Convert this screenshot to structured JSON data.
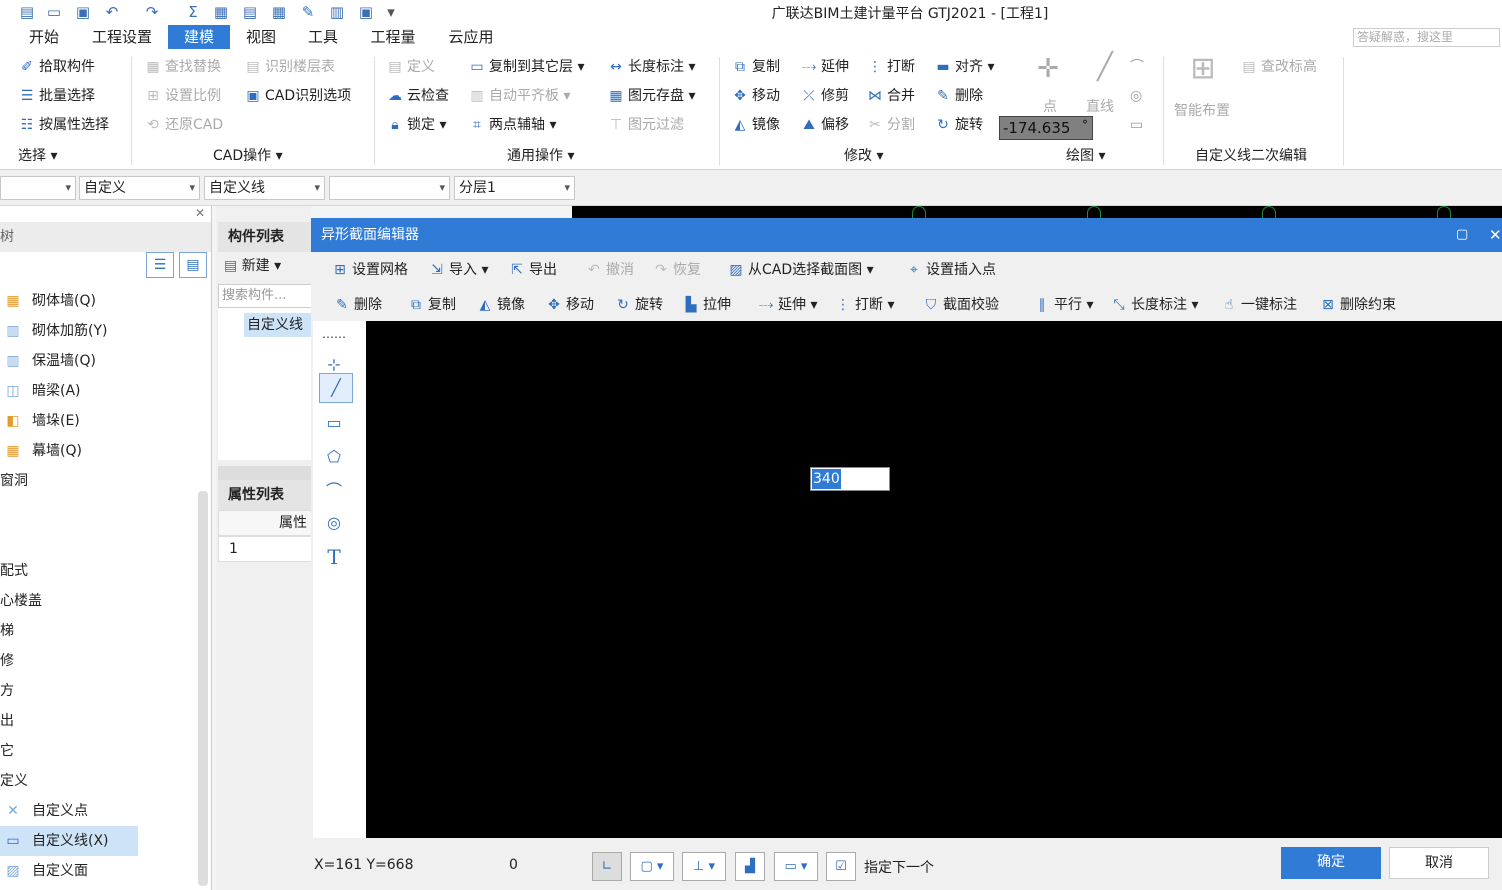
{
  "window": {
    "title": "广联达BIM土建计量平台 GTJ2021 - [工程1]",
    "help_placeholder": "答疑解惑，搜这里"
  },
  "tabs": [
    "开始",
    "工程设置",
    "建模",
    "视图",
    "工具",
    "工程量",
    "云应用"
  ],
  "ribbon": {
    "select": {
      "items": [
        "拾取构件",
        "批量选择",
        "按属性选择"
      ],
      "group": "选择"
    },
    "cad": {
      "items": [
        "查找替换",
        "识别楼层表",
        "设置比例",
        "CAD识别选项",
        "还原CAD"
      ],
      "group": "CAD操作"
    },
    "common": {
      "items": [
        "定义",
        "复制到其它层",
        "长度标注",
        "云检查",
        "自动平齐板",
        "图元存盘",
        "锁定",
        "两点辅轴",
        "图元过滤"
      ],
      "group": "通用操作"
    },
    "modify": {
      "items": [
        "复制",
        "延伸",
        "打断",
        "对齐",
        "移动",
        "修剪",
        "合并",
        "删除",
        "镜像",
        "偏移",
        "分割",
        "旋转"
      ],
      "group": "修改"
    },
    "draw": {
      "angle_value": "-174.635",
      "angle_unit": "°",
      "point": "点",
      "line": "直线",
      "group": "绘图"
    },
    "custom": {
      "smart_layout": "智能布置",
      "change_elev": "查改标高",
      "group": "自定义线二次编辑"
    }
  },
  "combos": [
    "",
    "自定义",
    "自定义线",
    "",
    "分层1"
  ],
  "left_panel": {
    "items": [
      "砌体墙(Q)",
      "砌体加筋(Y)",
      "保温墙(Q)",
      "暗梁(A)",
      "墙垛(E)",
      "幕墙(Q)",
      "窗洞",
      "配式",
      "心楼盖",
      "梯",
      "修",
      "方",
      "出",
      "它",
      "定义",
      "自定义点",
      "自定义线(X)",
      "自定义面"
    ],
    "partial_top": "树"
  },
  "middle_panel": {
    "header": "构件列表",
    "new": "新建",
    "search_placeholder": "搜索构件...",
    "item": "自定义线",
    "prop_header": "属性列表",
    "prop_col": "属性",
    "row1": "1"
  },
  "dialog": {
    "title": "异形截面编辑器",
    "toolbar1": [
      "设置网格",
      "导入",
      "导出",
      "撤消",
      "恢复",
      "从CAD选择截面图",
      "设置插入点"
    ],
    "toolbar2": [
      "删除",
      "复制",
      "镜像",
      "移动",
      "旋转",
      "拉伸",
      "延伸",
      "打断",
      "截面校验",
      "平行",
      "长度标注",
      "一键标注",
      "删除约束"
    ],
    "input_value": "340",
    "coords": "X=161 Y=668",
    "zero": "0",
    "prompt": "指定下一个",
    "ok": "确定",
    "cancel": "取消"
  }
}
